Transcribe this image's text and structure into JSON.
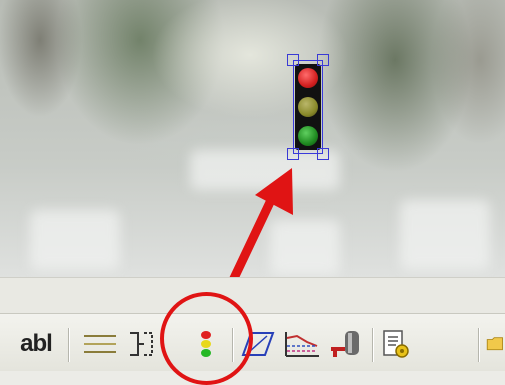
{
  "toolbar": {
    "text_tool_label": "abl",
    "items": [
      {
        "icon": "text-field-icon"
      },
      {
        "icon": "horizontal-lines-icon"
      },
      {
        "icon": "bracket-connector-icon"
      },
      {
        "icon": "traffic-light-icon"
      },
      {
        "icon": "parallelogram-icon"
      },
      {
        "icon": "chart-shape-icon"
      },
      {
        "icon": "pump-icon"
      },
      {
        "icon": "document-settings-icon"
      },
      {
        "icon": "folder-icon"
      }
    ]
  },
  "canvas_object": {
    "icon": "traffic-light-icon",
    "lamp_colors": [
      "#d42020",
      "#8a8a2a",
      "#1f8a20"
    ],
    "selected": true
  },
  "annotation": {
    "color": "#e01414",
    "highlight": "traffic-light-tool"
  }
}
